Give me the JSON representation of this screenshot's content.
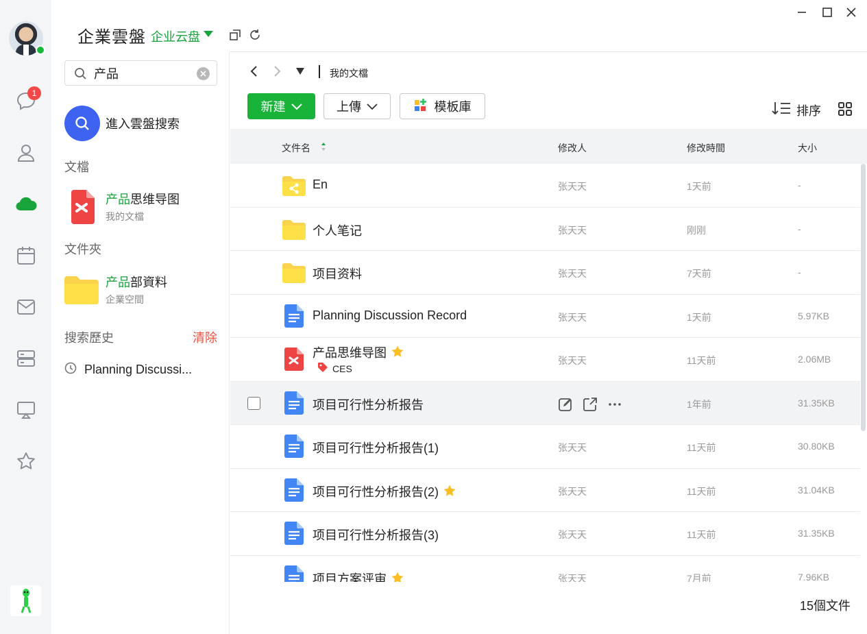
{
  "sidebar": {
    "notification_count": "1",
    "icons": [
      "chat-icon",
      "contacts-icon",
      "cloud-drive-icon",
      "calendar-icon",
      "mail-icon",
      "server-icon",
      "screen-share-icon",
      "star-icon"
    ]
  },
  "header": {
    "brand": "企業雲盤",
    "drive_selector": "企业云盘"
  },
  "search": {
    "value": "产品",
    "cloud_search_label": "進入雲盤搜索",
    "docs_section": "文檔",
    "doc_result": {
      "highlight": "产品",
      "rest": "思维导图",
      "location": "我的文檔"
    },
    "folder_section": "文件夾",
    "folder_result": {
      "highlight": "产品",
      "rest": "部資料",
      "location": "企業空間"
    },
    "history_section": "搜索歷史",
    "clear_label": "清除",
    "history": [
      "Planning Discussi..."
    ]
  },
  "main": {
    "breadcrumb": "我的文檔",
    "new_label": "新建",
    "upload_label": "上傳",
    "template_label": "模板庫",
    "sort_label": "排序",
    "columns": {
      "name": "文件名",
      "modifier": "修改人",
      "time": "修改時間",
      "size": "大小"
    },
    "files": [
      {
        "name": "En",
        "type": "shared-folder",
        "modifier": "张天天",
        "time": "1天前",
        "size": "-"
      },
      {
        "name": "个人笔记",
        "type": "folder",
        "modifier": "张天天",
        "time": "刚刚",
        "size": "-"
      },
      {
        "name": "项目资料",
        "type": "folder",
        "modifier": "张天天",
        "time": "7天前",
        "size": "-"
      },
      {
        "name": "Planning Discussion Record",
        "type": "doc",
        "modifier": "张天天",
        "time": "1天前",
        "size": "5.97KB"
      },
      {
        "name": "产品思维导图",
        "type": "mindmap",
        "starred": true,
        "tag": "CES",
        "modifier": "张天天",
        "time": "11天前",
        "size": "2.06MB"
      },
      {
        "name": "项目可行性分析报告",
        "type": "doc",
        "hovered": true,
        "modifier": "",
        "time": "1年前",
        "size": "31.35KB"
      },
      {
        "name": "项目可行性分析报告(1)",
        "type": "doc",
        "modifier": "张天天",
        "time": "11天前",
        "size": "30.80KB"
      },
      {
        "name": "项目可行性分析报告(2)",
        "type": "doc",
        "starred": true,
        "modifier": "张天天",
        "time": "11天前",
        "size": "31.04KB"
      },
      {
        "name": "项目可行性分析报告(3)",
        "type": "doc",
        "modifier": "张天天",
        "time": "11天前",
        "size": "31.35KB"
      },
      {
        "name": "项目方案评审",
        "type": "doc",
        "starred": true,
        "modifier": "张天天",
        "time": "7月前",
        "size": "7.96KB"
      }
    ],
    "file_count": "15個文件"
  },
  "colors": {
    "accent_green": "#19b33a",
    "clear_red": "#ef4f3d",
    "search_blue": "#3d63f0",
    "folder_yellow": "#fcd34d",
    "doc_blue": "#4285f4",
    "mindmap_red": "#ef4444"
  }
}
